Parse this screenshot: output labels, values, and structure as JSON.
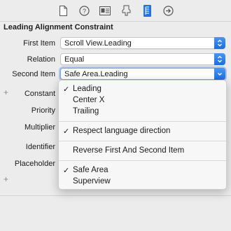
{
  "toolbar": {
    "icons": [
      "file-inspector-icon",
      "quick-help-icon",
      "identity-inspector-icon",
      "attributes-inspector-icon",
      "size-inspector-icon",
      "connections-inspector-icon"
    ],
    "active": "size-inspector-icon",
    "accent": "#1f74e0"
  },
  "section": {
    "title": "Leading Alignment Constraint"
  },
  "fields": {
    "first_item": {
      "label": "First Item",
      "value": "Scroll View.Leading"
    },
    "relation": {
      "label": "Relation",
      "value": "Equal"
    },
    "second_item": {
      "label": "Second Item",
      "value": "Safe Area.Leading"
    },
    "constant": {
      "label": "Constant"
    },
    "priority": {
      "label": "Priority"
    },
    "multiplier": {
      "label": "Multiplier"
    },
    "identifier": {
      "label": "Identifier"
    },
    "placeholder": {
      "label": "Placeholder"
    }
  },
  "plus_symbol": "+",
  "menu": {
    "items": [
      {
        "label": "Leading",
        "checked": true,
        "check": "✓"
      },
      {
        "label": "Center X",
        "checked": false,
        "check": ""
      },
      {
        "label": "Trailing",
        "checked": false,
        "check": ""
      },
      {
        "label": "Respect language direction",
        "checked": true,
        "check": "✓"
      },
      {
        "label": "Reverse First And Second Item",
        "checked": false,
        "check": ""
      },
      {
        "label": "Safe Area",
        "checked": true,
        "check": "✓"
      },
      {
        "label": "Superview",
        "checked": false,
        "check": ""
      }
    ]
  }
}
